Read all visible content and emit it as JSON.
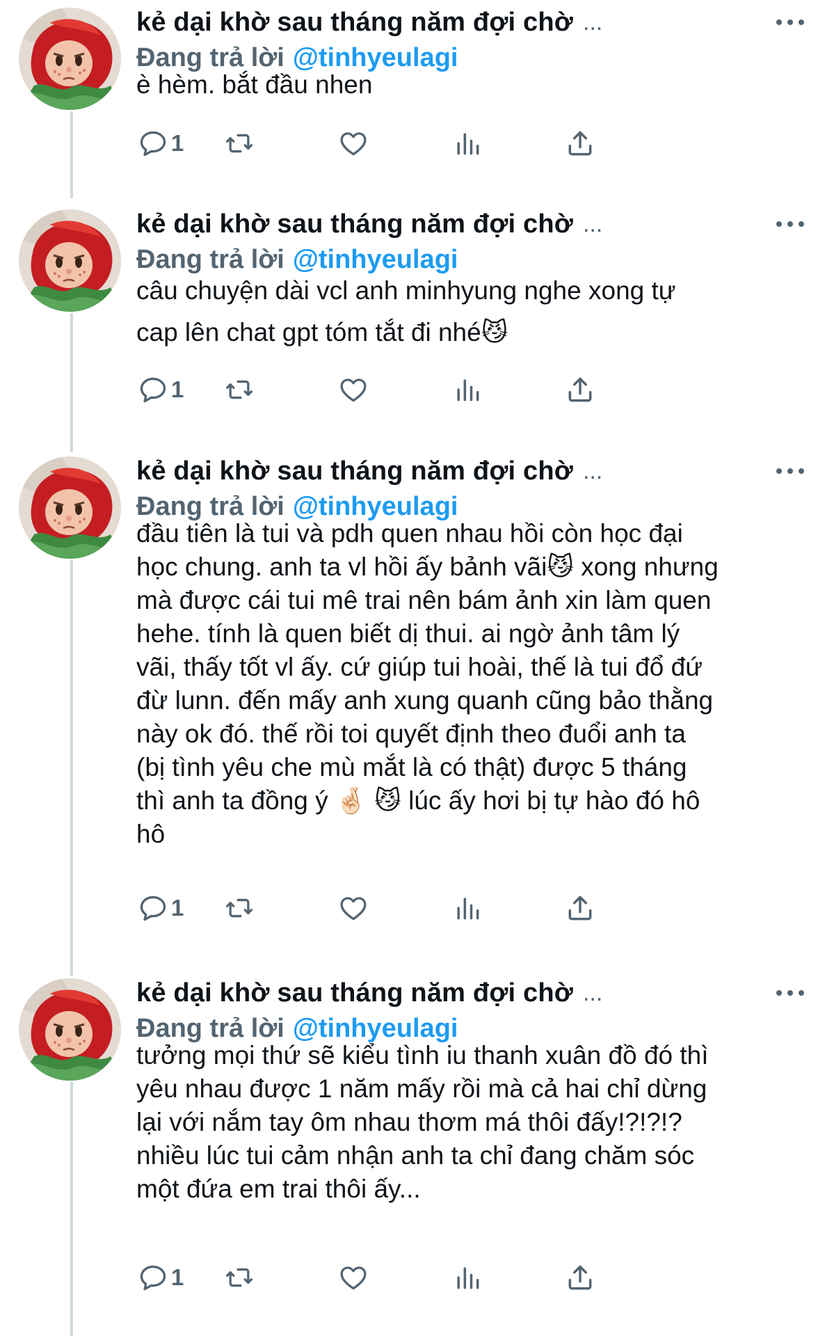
{
  "thread": {
    "author_name": "kẻ dại khờ sau tháng năm đợi chờ",
    "truncation": "...",
    "reply_prefix": "Đang trả lời",
    "reply_handle": "@tinhyeulagi"
  },
  "tweets": [
    {
      "text": "è hèm. bắt đầu nhen",
      "reply_count": "1"
    },
    {
      "text": "câu chuyện dài vcl anh minhyung nghe xong tự\ncap lên chat gpt tóm tắt đi nhé😼",
      "reply_count": "1"
    },
    {
      "text": "đầu tiên là tui và pdh quen nhau hồi còn học đại\nhọc chung. anh ta vl hồi ấy bảnh vãi😼 xong nhưng\nmà được cái tui mê trai nên bám ảnh xin làm quen\nhehe. tính là quen biết dị thui. ai ngờ ảnh tâm lý\nvãi, thấy tốt vl ấy. cứ giúp tui hoài, thế là tui đổ đứ\nđừ lunn. đến mấy anh xung quanh cũng bảo thằng\nnày ok đó. thế rồi toi quyết định theo đuổi anh ta\n(bị tình yêu che mù mắt là có thật) được 5 tháng\nthì anh ta đồng ý 🤞🏻 😼 lúc ấy hơi bị tự hào đó hô\nhô",
      "reply_count": "1"
    },
    {
      "text": "tưởng mọi thứ sẽ kiểu tình iu thanh xuân đồ đó thì\nyêu nhau được 1 năm mấy rồi mà cả hai chỉ dừng\nlại với nắm tay ôm nhau thơm má thôi đấy!?!?!?\nnhiều lúc tui cảm nhận anh ta chỉ đang chăm sóc\nmột đứa em trai thôi ấy...",
      "reply_count": "1"
    }
  ],
  "icons": {
    "avatar": "red-hood-figure-avatar",
    "more": "more-dots-icon",
    "reply": "reply-bubble-icon",
    "retweet": "retweet-icon",
    "like": "heart-icon",
    "views": "views-bars-icon",
    "share": "share-upload-icon"
  },
  "colors": {
    "text": "#0f1419",
    "secondary": "#536471",
    "link": "#1d9bf0",
    "thread_line": "#cfd9de"
  }
}
